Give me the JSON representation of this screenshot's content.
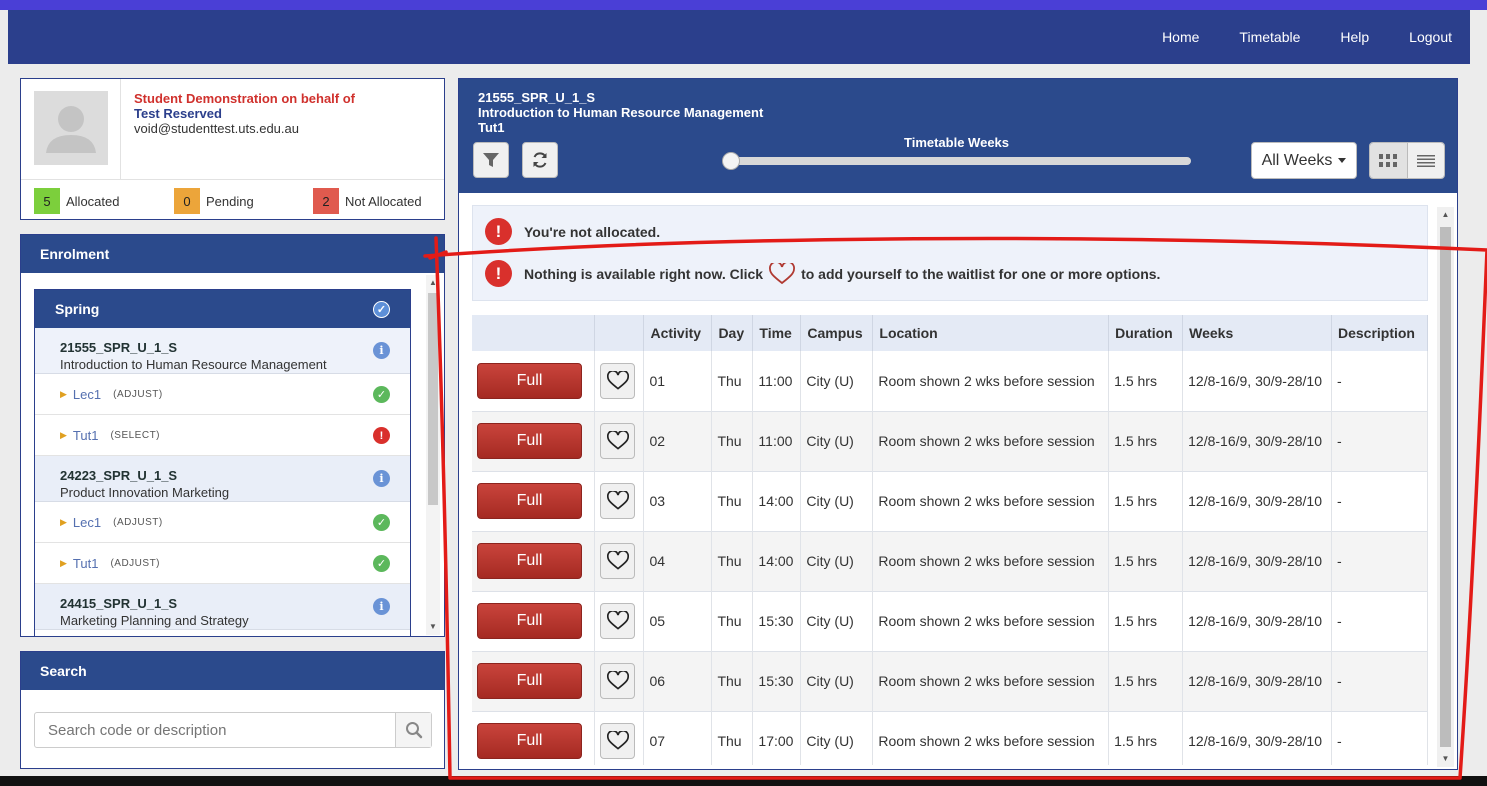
{
  "nav": {
    "links": [
      "Home",
      "Timetable",
      "Help",
      "Logout"
    ]
  },
  "profile": {
    "demo_text": "Student Demonstration on behalf of",
    "name": "Test Reserved",
    "email": "void@studenttest.uts.edu.au",
    "counts": [
      {
        "value": "5",
        "label": "Allocated",
        "color": "#7ccf3c"
      },
      {
        "value": "0",
        "label": "Pending",
        "color": "#eca53a"
      },
      {
        "value": "2",
        "label": "Not Allocated",
        "color": "#e05a4e"
      }
    ]
  },
  "enrolment": {
    "title": "Enrolment",
    "term": "Spring",
    "subjects": [
      {
        "code": "21555_SPR_U_1_S",
        "name": "Introduction to Human Resource Management",
        "activities": [
          {
            "name": "Lec1",
            "tag": "(ADJUST)",
            "status": "ok"
          },
          {
            "name": "Tut1",
            "tag": "(SELECT)",
            "status": "error"
          }
        ]
      },
      {
        "code": "24223_SPR_U_1_S",
        "name": "Product Innovation Marketing",
        "activities": [
          {
            "name": "Lec1",
            "tag": "(ADJUST)",
            "status": "ok"
          },
          {
            "name": "Tut1",
            "tag": "(ADJUST)",
            "status": "ok"
          }
        ]
      },
      {
        "code": "24415_SPR_U_1_S",
        "name": "Marketing Planning and Strategy",
        "activities": []
      }
    ]
  },
  "search": {
    "title": "Search",
    "placeholder": "Search code or description"
  },
  "main": {
    "code": "21555_SPR_U_1_S",
    "name": "Introduction to Human Resource Management",
    "activity": "Tut1",
    "weeks_label": "Timetable Weeks",
    "weeks_select": "All Weeks",
    "alerts": {
      "not_allocated": "You're not allocated.",
      "waitlist_before": "Nothing is available right now. Click",
      "waitlist_after": "to add yourself to the waitlist for one or more options."
    },
    "table": {
      "headers": [
        "",
        "",
        "Activity",
        "Day",
        "Time",
        "Campus",
        "Location",
        "Duration",
        "Weeks",
        "Description"
      ],
      "button_label": "Full",
      "rows": [
        {
          "activity": "01",
          "day": "Thu",
          "time": "11:00",
          "campus": "City (U)",
          "location": "Room shown 2 wks before session",
          "duration": "1.5 hrs",
          "weeks": "12/8-16/9, 30/9-28/10",
          "description": "-"
        },
        {
          "activity": "02",
          "day": "Thu",
          "time": "11:00",
          "campus": "City (U)",
          "location": "Room shown 2 wks before session",
          "duration": "1.5 hrs",
          "weeks": "12/8-16/9, 30/9-28/10",
          "description": "-"
        },
        {
          "activity": "03",
          "day": "Thu",
          "time": "14:00",
          "campus": "City (U)",
          "location": "Room shown 2 wks before session",
          "duration": "1.5 hrs",
          "weeks": "12/8-16/9, 30/9-28/10",
          "description": "-"
        },
        {
          "activity": "04",
          "day": "Thu",
          "time": "14:00",
          "campus": "City (U)",
          "location": "Room shown 2 wks before session",
          "duration": "1.5 hrs",
          "weeks": "12/8-16/9, 30/9-28/10",
          "description": "-"
        },
        {
          "activity": "05",
          "day": "Thu",
          "time": "15:30",
          "campus": "City (U)",
          "location": "Room shown 2 wks before session",
          "duration": "1.5 hrs",
          "weeks": "12/8-16/9, 30/9-28/10",
          "description": "-"
        },
        {
          "activity": "06",
          "day": "Thu",
          "time": "15:30",
          "campus": "City (U)",
          "location": "Room shown 2 wks before session",
          "duration": "1.5 hrs",
          "weeks": "12/8-16/9, 30/9-28/10",
          "description": "-"
        },
        {
          "activity": "07",
          "day": "Thu",
          "time": "17:00",
          "campus": "City (U)",
          "location": "Room shown 2 wks before session",
          "duration": "1.5 hrs",
          "weeks": "12/8-16/9, 30/9-28/10",
          "description": "-"
        }
      ]
    }
  }
}
